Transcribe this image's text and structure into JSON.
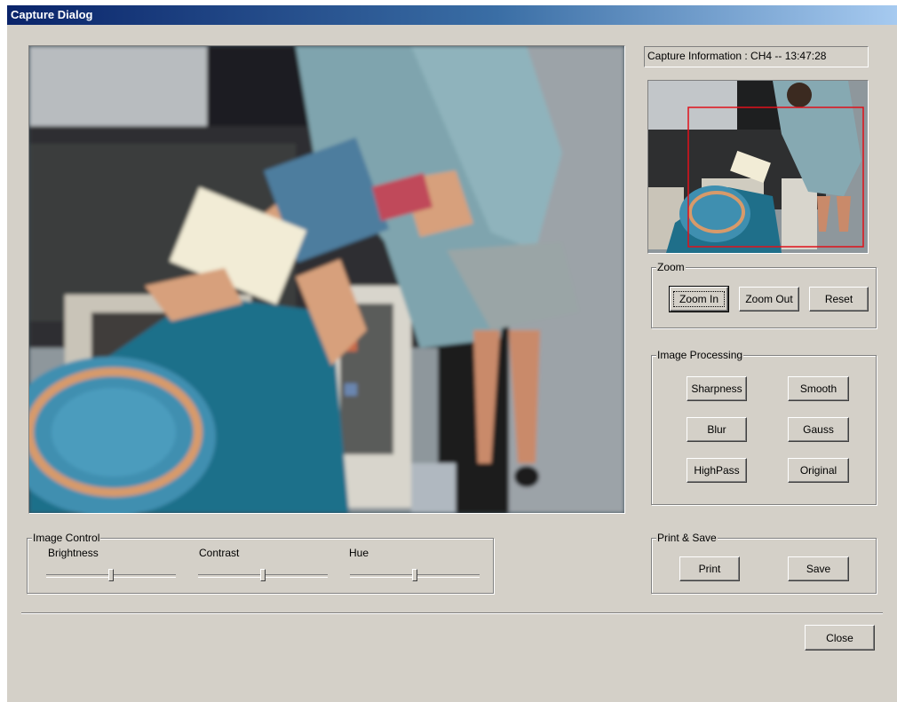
{
  "window": {
    "title": "Capture Dialog"
  },
  "capture_info": "Capture Information : CH4 -- 13:47:28",
  "zoom": {
    "label": "Zoom",
    "zoom_in": "Zoom In",
    "zoom_out": "Zoom Out",
    "reset": "Reset"
  },
  "image_processing": {
    "label": "Image Processing",
    "sharpness": "Sharpness",
    "smooth": "Smooth",
    "blur": "Blur",
    "gauss": "Gauss",
    "highpass": "HighPass",
    "original": "Original"
  },
  "image_control": {
    "label": "Image Control",
    "brightness": {
      "label": "Brightness",
      "value": 0.5
    },
    "contrast": {
      "label": "Contrast",
      "value": 0.5
    },
    "hue": {
      "label": "Hue",
      "value": 0.5
    }
  },
  "print_save": {
    "label": "Print & Save",
    "print": "Print",
    "save": "Save"
  },
  "close": "Close",
  "colors": {
    "title_start": "#0a246a",
    "title_end": "#a6caf0",
    "dialog_bg": "#d4d0c8",
    "zoom_rect": "#e0101a"
  }
}
